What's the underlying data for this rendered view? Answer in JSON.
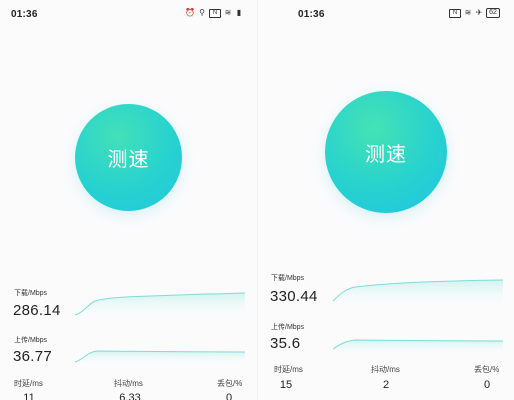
{
  "left": {
    "status": {
      "time": "01:36",
      "icons": [
        "alarm-icon",
        "location-icon",
        "nfc-icon",
        "wifi-icon",
        "signal-icon"
      ]
    },
    "button": {
      "label": "测速"
    },
    "download": {
      "label": "下载/Mbps",
      "value": "286.14"
    },
    "upload": {
      "label": "上传/Mbps",
      "value": "36.77"
    },
    "stats": {
      "latency": {
        "label": "时延/ms",
        "value": "11"
      },
      "jitter": {
        "label": "抖动/ms",
        "value": "6.33"
      },
      "loss": {
        "label": "丢包/%",
        "value": "0"
      }
    }
  },
  "right": {
    "status": {
      "time": "01:36",
      "battery": "62",
      "icons": [
        "nfc-icon",
        "wifi-icon",
        "airplane-icon",
        "battery-icon"
      ]
    },
    "button": {
      "label": "测速"
    },
    "download": {
      "label": "下载/Mbps",
      "value": "330.44"
    },
    "upload": {
      "label": "上传/Mbps",
      "value": "35.6"
    },
    "stats": {
      "latency": {
        "label": "时延/ms",
        "value": "15"
      },
      "jitter": {
        "label": "抖动/ms",
        "value": "2"
      },
      "loss": {
        "label": "丢包/%",
        "value": "0"
      }
    }
  },
  "colors": {
    "accent": "#28d0cf",
    "accent_light": "#a9ece6",
    "text": "#222222"
  }
}
